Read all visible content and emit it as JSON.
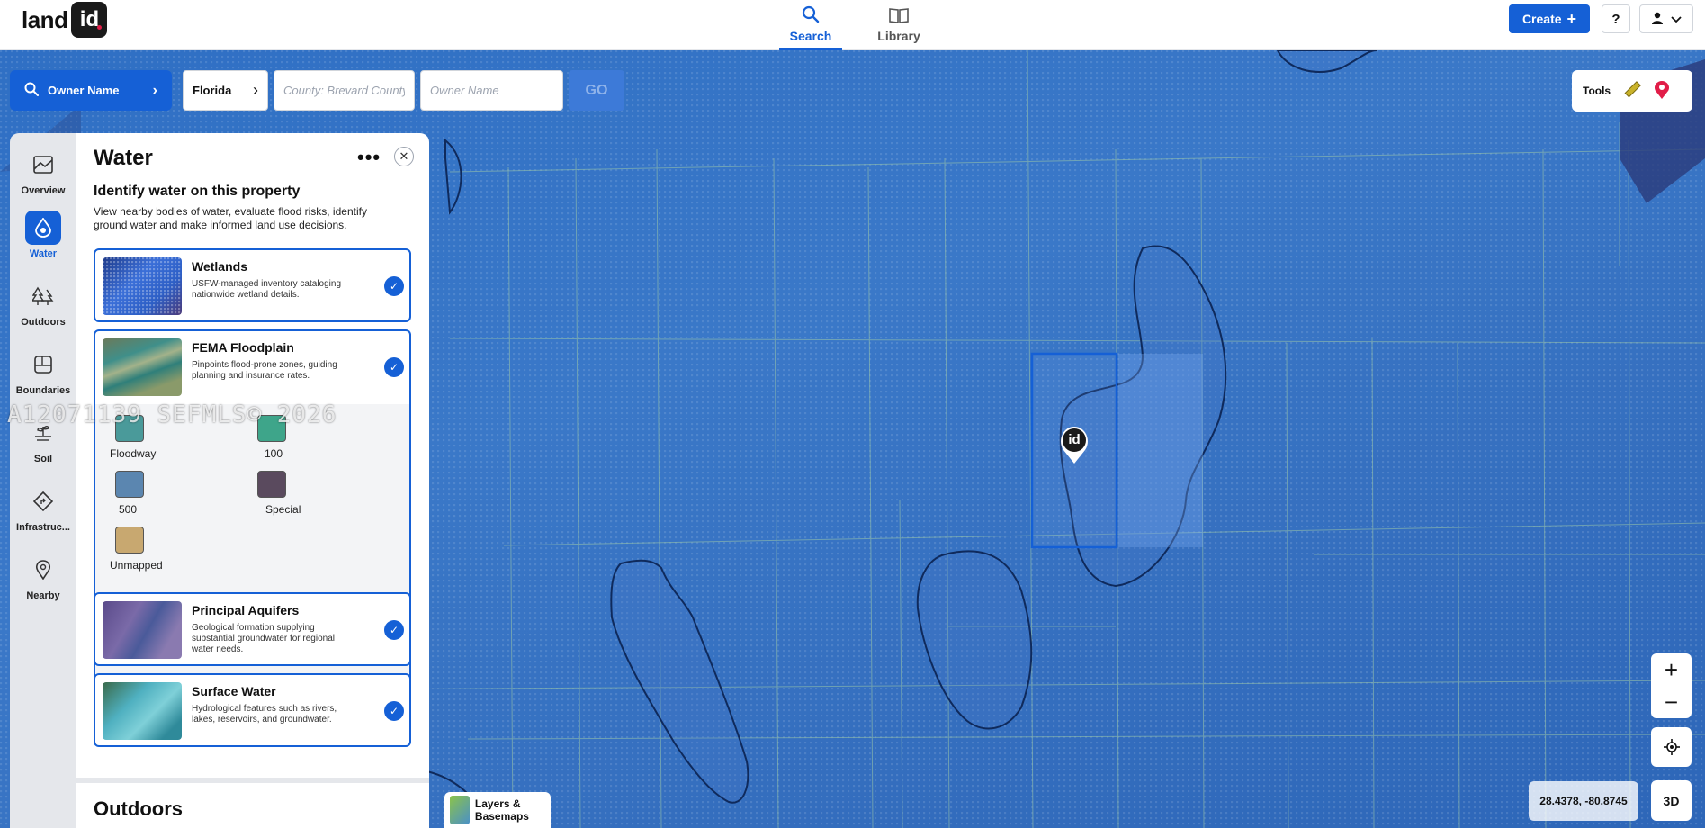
{
  "header": {
    "logo_text": "land",
    "logo_badge": "id",
    "tabs": [
      {
        "label": "Search",
        "icon": "search-icon",
        "active": true
      },
      {
        "label": "Library",
        "icon": "book-icon",
        "active": false
      }
    ],
    "create_label": "Create",
    "help_label": "?"
  },
  "search": {
    "mode_label": "Owner Name",
    "state_value": "Florida",
    "county_placeholder": "County: Brevard County",
    "owner_placeholder": "Owner Name",
    "go_label": "GO"
  },
  "tools": {
    "label": "Tools"
  },
  "sidebar": {
    "items": [
      {
        "label": "Overview",
        "icon": "overview-icon"
      },
      {
        "label": "Water",
        "icon": "water-drop-icon",
        "active": true
      },
      {
        "label": "Outdoors",
        "icon": "trees-icon"
      },
      {
        "label": "Boundaries",
        "icon": "boundaries-icon"
      },
      {
        "label": "Soil",
        "icon": "soil-icon"
      },
      {
        "label": "Infrastruc...",
        "icon": "infrastructure-icon"
      },
      {
        "label": "Nearby",
        "icon": "location-pin-icon"
      }
    ]
  },
  "panel": {
    "title": "Water",
    "subtitle": "Identify water on this property",
    "description": "View nearby bodies of water, evaluate flood risks, identify ground water and make informed land use decisions.",
    "layers": [
      {
        "name": "Wetlands",
        "description": "USFW-managed inventory cataloging nationwide wetland details.",
        "checked": true
      },
      {
        "name": "FEMA Floodplain",
        "description": "Pinpoints flood-prone zones, guiding planning and insurance rates.",
        "checked": true
      },
      {
        "name": "Principal Aquifers",
        "description": "Geological formation supplying substantial groundwater for regional water needs.",
        "checked": true
      },
      {
        "name": "Surface Water",
        "description": "Hydrological features such as rivers, lakes, reservoirs, and groundwater.",
        "checked": true
      }
    ],
    "legend": [
      {
        "label": "Floodway",
        "color": "#4a9a9a"
      },
      {
        "label": "100",
        "color": "#3ea58a"
      },
      {
        "label": "500",
        "color": "#5b86b0"
      },
      {
        "label": "Special",
        "color": "#5a4a5e"
      },
      {
        "label": "Unmapped",
        "color": "#c8a870"
      }
    ],
    "next_section": "Outdoors"
  },
  "watermark": "A12071139 SEFMLS© 2026",
  "map": {
    "layers_button": "Layers & Basemaps",
    "coords": "28.4378, -80.8745",
    "zoom_in": "+",
    "zoom_out": "−",
    "btn_3d": "3D",
    "marker_label": "id"
  },
  "colors": {
    "accent": "#1560d6",
    "map_water": "#3a78c8"
  }
}
